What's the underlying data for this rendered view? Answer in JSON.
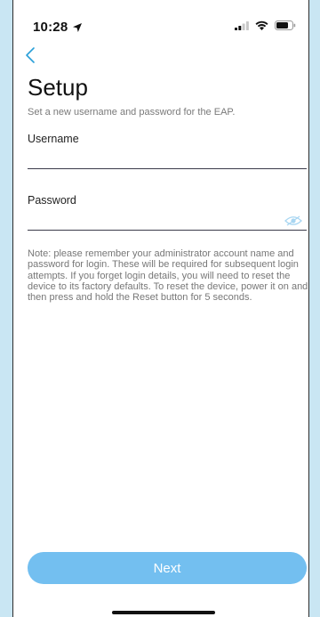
{
  "status_bar": {
    "time": "10:28",
    "icons": [
      "location-arrow-icon",
      "signal-icon",
      "wifi-icon",
      "battery-icon"
    ]
  },
  "nav": {
    "back_icon": "chevron-left-icon"
  },
  "page": {
    "title": "Setup",
    "subtitle": "Set a new username and password for the EAP."
  },
  "form": {
    "username_label": "Username",
    "username_value": "",
    "password_label": "Password",
    "password_value": "",
    "password_toggle_icon": "eye-icon"
  },
  "note": "Note: please remember your administrator account name and password for login. These will be required for subsequent login attempts. If you forget login details, you will need to reset the device to its factory defaults. To reset the device, power it on and then press and hold the Reset button for 5 seconds.",
  "actions": {
    "next_label": "Next"
  },
  "colors": {
    "accent": "#73bff0",
    "back_chevron": "#2a9fd8",
    "background": "#c9e6f3"
  }
}
